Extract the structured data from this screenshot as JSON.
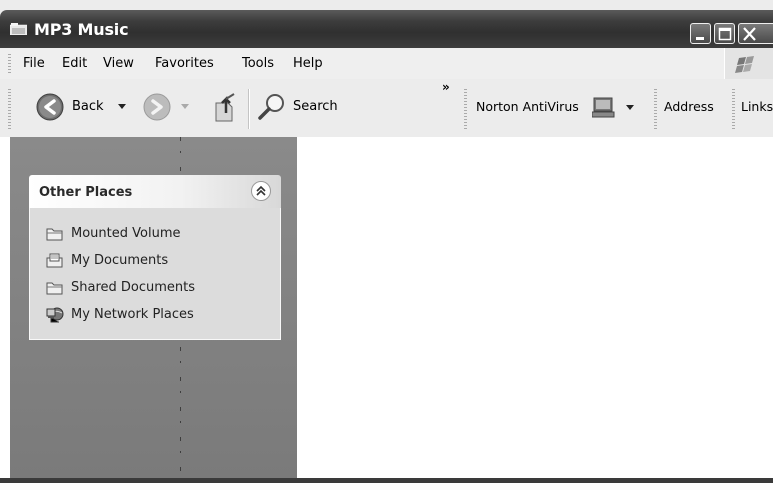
{
  "window": {
    "title": "MP3 Music"
  },
  "menu": {
    "items": [
      "File",
      "Edit",
      "View",
      "Favorites",
      "Tools",
      "Help"
    ]
  },
  "toolbar": {
    "back_label": "Back",
    "search_label": "Search",
    "overflow": "»",
    "norton_label": "Norton AntiVirus",
    "address_label": "Address",
    "links_label": "Links"
  },
  "sidebar": {
    "panel_title": "Other Places",
    "places": [
      {
        "label": "Mounted Volume",
        "icon": "folder-icon"
      },
      {
        "label": "My Documents",
        "icon": "documents-folder-icon"
      },
      {
        "label": "Shared Documents",
        "icon": "folder-icon"
      },
      {
        "label": "My Network Places",
        "icon": "network-places-icon"
      }
    ]
  }
}
